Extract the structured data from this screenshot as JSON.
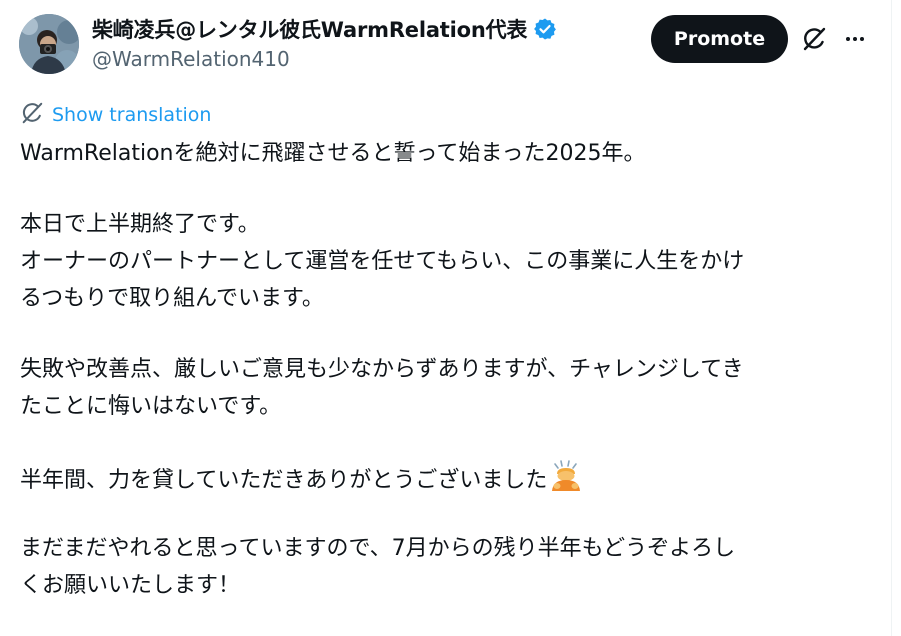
{
  "post": {
    "author": {
      "display_name": "柴崎凌兵@レンタル彼氏WarmRelation代表",
      "handle": "@WarmRelation410",
      "verified": true,
      "verified_color": "#1d9bf0"
    },
    "actions": {
      "promote_label": "Promote",
      "grok_icon": "grok-icon",
      "more_icon": "more-icon"
    },
    "translation": {
      "label": "Show translation",
      "icon": "translate-icon",
      "color": "#1d9bf0"
    },
    "body": {
      "lines": [
        "WarmRelationを絶対に飛躍させると誓って始まった2025年。",
        "",
        "本日で上半期終了です。",
        "オーナーのパートナーとして運営を任せてもらい、この事業に人生をかけ",
        "るつもりで取り組んでいます。",
        "",
        "失敗や改善点、厳しいご意見も少なからずありますが、チャレンジしてき",
        "たことに悔いはないです。",
        "",
        "半年間、力を貸していただきありがとうございました",
        "",
        "まだまだやれると思っていますので、7月からの残り半年もどうぞよろし",
        "くお願いいたします！"
      ],
      "emoji_after_line_index": 9,
      "emoji": "bowing-person-emoji"
    }
  },
  "colors": {
    "text": "#0f1419",
    "secondary_text": "#536471",
    "promote_bg": "#0f1419",
    "link": "#1d9bf0"
  }
}
